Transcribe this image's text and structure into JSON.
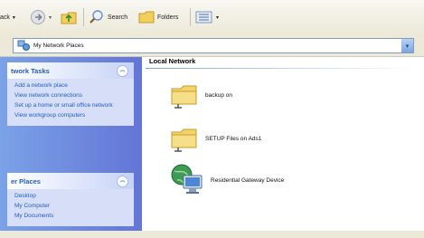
{
  "toolbar": {
    "back_label": "ack",
    "search_label": "Search",
    "folders_label": "Folders"
  },
  "address": {
    "value": "My Network Places"
  },
  "sidebar": {
    "network_tasks": {
      "title": "twork Tasks",
      "links": [
        "Add a network place",
        "View network connections",
        "Set up a home or small office network",
        "View workgroup computers"
      ]
    },
    "other_places": {
      "title": "er Places",
      "links": [
        "Desktop",
        "My Computer",
        "My Documents"
      ]
    }
  },
  "content": {
    "group_title": "Local Network",
    "items": [
      {
        "label": "backup on",
        "icon": "network-folder-icon"
      },
      {
        "label": "SETUP Files on Ads1",
        "icon": "network-folder-icon"
      },
      {
        "label": "Residential Gateway Device",
        "icon": "gateway-device-icon"
      }
    ]
  },
  "colors": {
    "taskpane": "#6e8fdf",
    "link": "#215dc6",
    "accent": "#3a6fd8"
  }
}
